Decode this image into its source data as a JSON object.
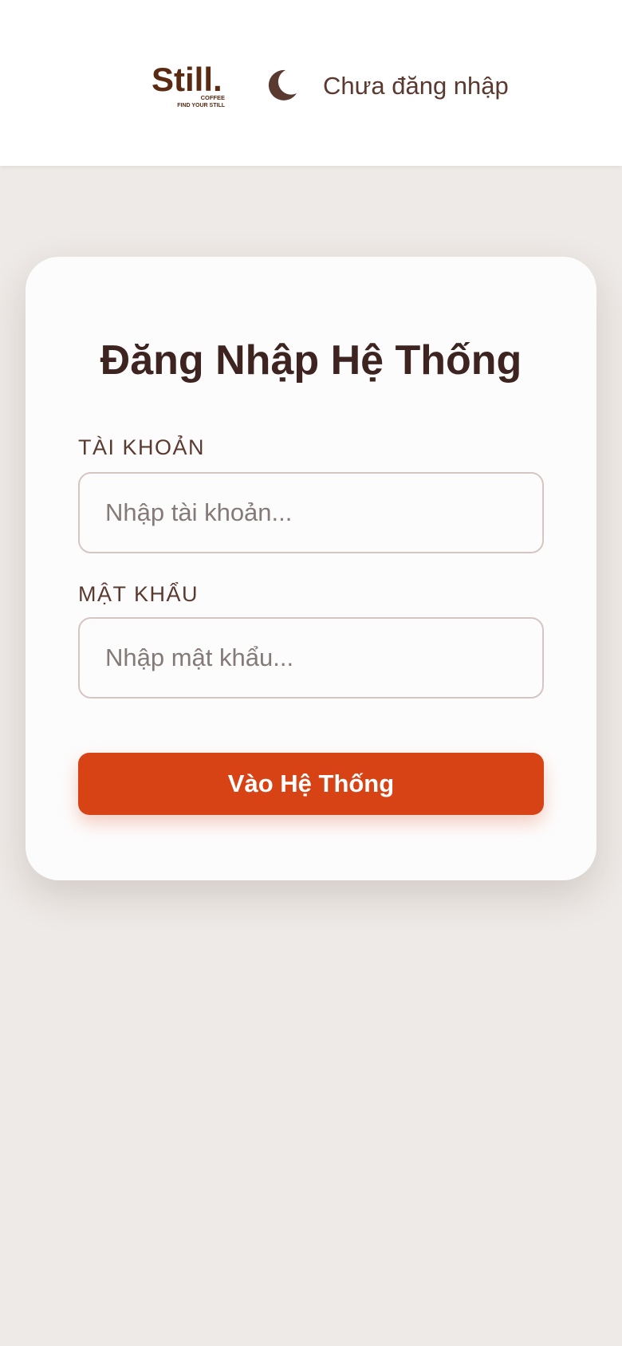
{
  "header": {
    "logo_text": "Still.",
    "logo_sub_1": "COFFEE",
    "logo_sub_2": "FIND YOUR STILL",
    "theme_icon": "moon-icon",
    "status_text": "Chưa đăng nhập"
  },
  "login": {
    "title": "Đăng Nhập Hệ Thống",
    "username_label": "TÀI KHOẢN",
    "username_placeholder": "Nhập tài khoản...",
    "username_value": "",
    "password_label": "MẬT KHẨU",
    "password_placeholder": "Nhập mật khẩu...",
    "password_value": "",
    "submit_label": "Vào Hệ Thống"
  },
  "colors": {
    "brand_brown": "#5a2a12",
    "text_brown": "#5a3a30",
    "title_brown": "#3d2420",
    "accent_orange": "#d84315",
    "page_bg": "#eeeae7"
  }
}
